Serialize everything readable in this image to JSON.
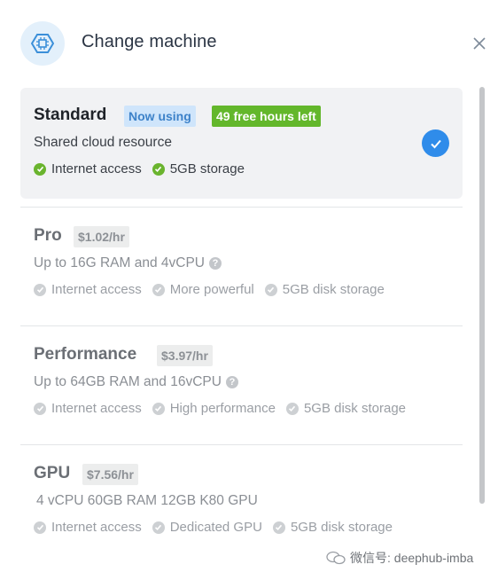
{
  "dialog": {
    "title": "Change machine",
    "icon": "chip-icon",
    "close_icon": "close-icon"
  },
  "colors": {
    "accent": "#2f8cea",
    "free_badge": "#63b72b",
    "now_badge_bg": "#cfe5fb",
    "now_badge_text": "#3d82c9",
    "check_green": "#6ab42e"
  },
  "machines": [
    {
      "name": "Standard",
      "badges": [
        "Now using",
        "49 free hours left"
      ],
      "description": "Shared cloud resource",
      "features": [
        "Internet access",
        "5GB storage"
      ],
      "selected": true
    },
    {
      "name": "Pro",
      "price": "$1.02/hr",
      "description": "Up to 16G RAM and 4vCPU",
      "features": [
        "Internet access",
        "More powerful",
        "5GB disk storage"
      ]
    },
    {
      "name": "Performance",
      "price": "$3.97/hr",
      "description": "Up to 64GB RAM and 16vCPU",
      "features": [
        "Internet access",
        "High performance",
        "5GB disk storage"
      ]
    },
    {
      "name": "GPU",
      "price": "$7.56/hr",
      "description": "4 vCPU 60GB RAM 12GB K80 GPU",
      "features": [
        "Internet access",
        "Dedicated GPU",
        "5GB disk storage"
      ]
    }
  ],
  "watermark": "微信号: deephub-imba"
}
